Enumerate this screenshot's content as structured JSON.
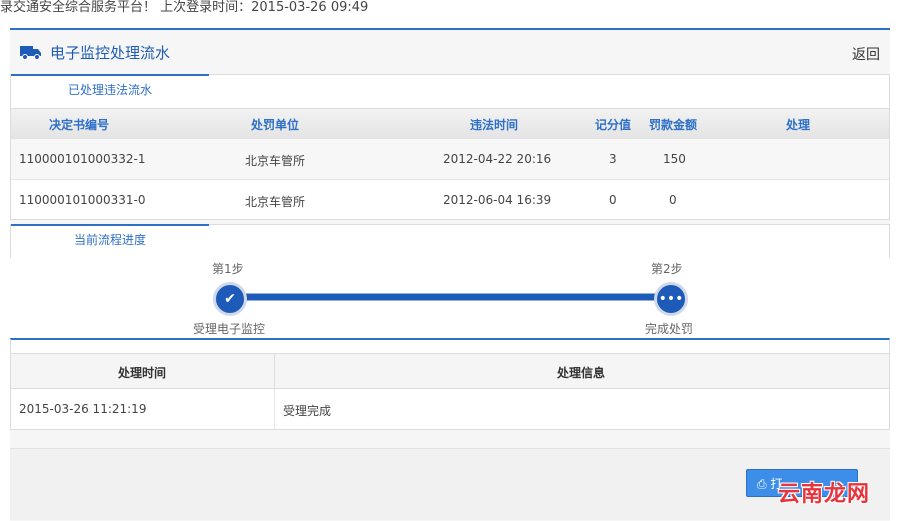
{
  "top_bar": {
    "text": "录交通安全综合服务平台！ 上次登录时间：2015-03-26 09:49"
  },
  "panel": {
    "title": "电子监控处理流水",
    "back": "返回"
  },
  "violations": {
    "tab": "已处理违法流水",
    "headers": [
      "决定书编号",
      "处罚单位",
      "违法时间",
      "记分值",
      "罚款金额",
      "处理"
    ],
    "rows": [
      [
        "110000101000332-1",
        "北京车管所",
        "2012-04-22 20:16",
        "3",
        "150",
        ""
      ],
      [
        "110000101000331-0",
        "北京车管所",
        "2012-06-04 16:39",
        "0",
        "0",
        ""
      ]
    ]
  },
  "progress": {
    "tab": "当前流程进度",
    "steps": [
      {
        "label": "第1步",
        "caption": "受理电子监控",
        "icon": "check-icon"
      },
      {
        "label": "第2步",
        "caption": "完成处罚",
        "icon": "ellipsis-icon"
      }
    ]
  },
  "history": {
    "headers": [
      "处理时间",
      "处理信息"
    ],
    "rows": [
      [
        "2015-03-26 11:21:19",
        "受理完成"
      ]
    ]
  },
  "print_button": {
    "label": "打"
  },
  "watermark": {
    "text": "云南龙网"
  },
  "colors": {
    "accent": "#2e6fc8",
    "button": "#3d8ee8",
    "watermark": "#e8343c"
  }
}
